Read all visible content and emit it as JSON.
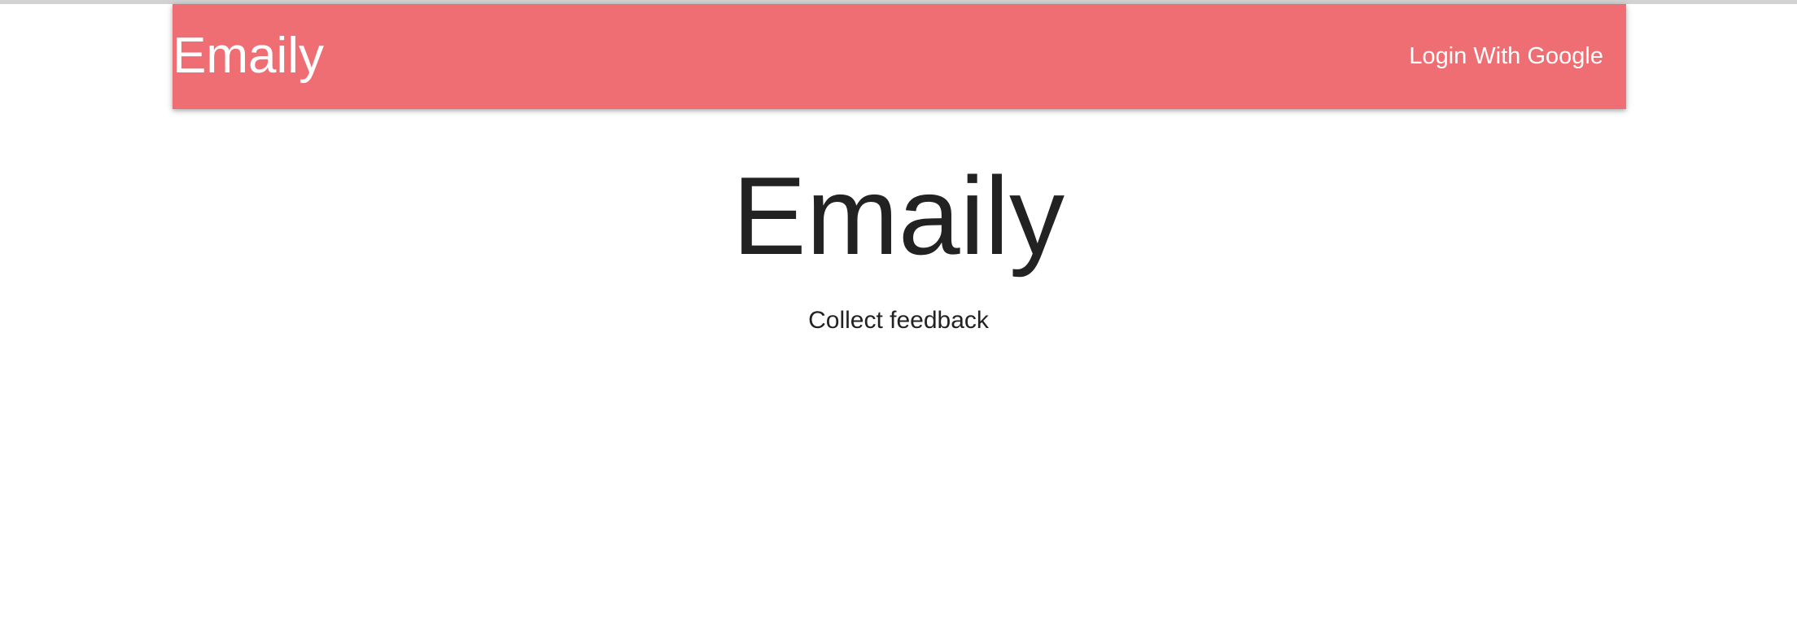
{
  "header": {
    "brand": "Emaily",
    "login_label": "Login With Google"
  },
  "hero": {
    "title": "Emaily",
    "subtitle": "Collect feedback"
  },
  "colors": {
    "navbar": "#ee6e73",
    "text": "#222222",
    "nav_text": "#ffffff"
  }
}
